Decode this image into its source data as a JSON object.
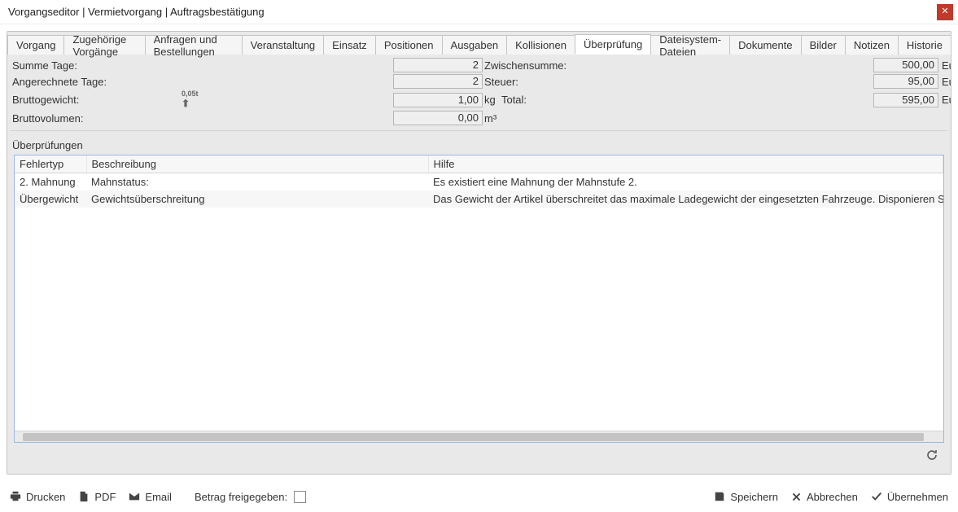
{
  "window": {
    "title": "Vorgangseditor | Vermietvorgang | Auftragsbestätigung"
  },
  "tabs": [
    {
      "label": "Vorgang"
    },
    {
      "label": "Zugehörige Vorgänge"
    },
    {
      "label": "Anfragen und Bestellungen"
    },
    {
      "label": "Veranstaltung"
    },
    {
      "label": "Einsatz"
    },
    {
      "label": "Positionen"
    },
    {
      "label": "Ausgaben"
    },
    {
      "label": "Kollisionen"
    },
    {
      "label": "Überprüfung"
    },
    {
      "label": "Dateisystem-Dateien"
    },
    {
      "label": "Dokumente"
    },
    {
      "label": "Bilder"
    },
    {
      "label": "Notizen"
    },
    {
      "label": "Historie"
    }
  ],
  "active_tab_index": 8,
  "summary": {
    "summe_tage_label": "Summe Tage:",
    "summe_tage_value": "2",
    "angerechnete_tage_label": "Angerechnete Tage:",
    "angerechnete_tage_value": "2",
    "bruttogewicht_label": "Bruttogewicht:",
    "bruttogewicht_icon_text": "0,05t",
    "bruttogewicht_value": "1,00",
    "bruttogewicht_unit": "kg",
    "bruttovolumen_label": "Bruttovolumen:",
    "bruttovolumen_value": "0,00",
    "bruttovolumen_unit": "m³",
    "zwischensumme_label": "Zwischensumme:",
    "zwischensumme_value": "500,00",
    "steuer_label": "Steuer:",
    "steuer_value": "95,00",
    "total_label": "Total:",
    "total_value": "595,00",
    "currency": "Eur"
  },
  "checks_section_label": "Überprüfungen",
  "checks_table": {
    "headers": {
      "fehlertyp": "Fehlertyp",
      "beschreibung": "Beschreibung",
      "hilfe": "Hilfe"
    },
    "rows": [
      {
        "fehlertyp": "2. Mahnung",
        "beschreibung": "Mahnstatus:",
        "hilfe": "Es existiert eine Mahnung der Mahnstufe 2."
      },
      {
        "fehlertyp": "Übergewicht",
        "beschreibung": "Gewichtsüberschreitung",
        "hilfe": "Das Gewicht der Artikel überschreitet das maximale Ladegewicht der eingesetzten Fahrzeuge. Disponieren Sie weitere Fa"
      }
    ]
  },
  "footer": {
    "drucken": "Drucken",
    "pdf": "PDF",
    "email": "Email",
    "betrag_freigegeben": "Betrag freigegeben:",
    "speichern": "Speichern",
    "abbrechen": "Abbrechen",
    "uebernehmen": "Übernehmen"
  }
}
